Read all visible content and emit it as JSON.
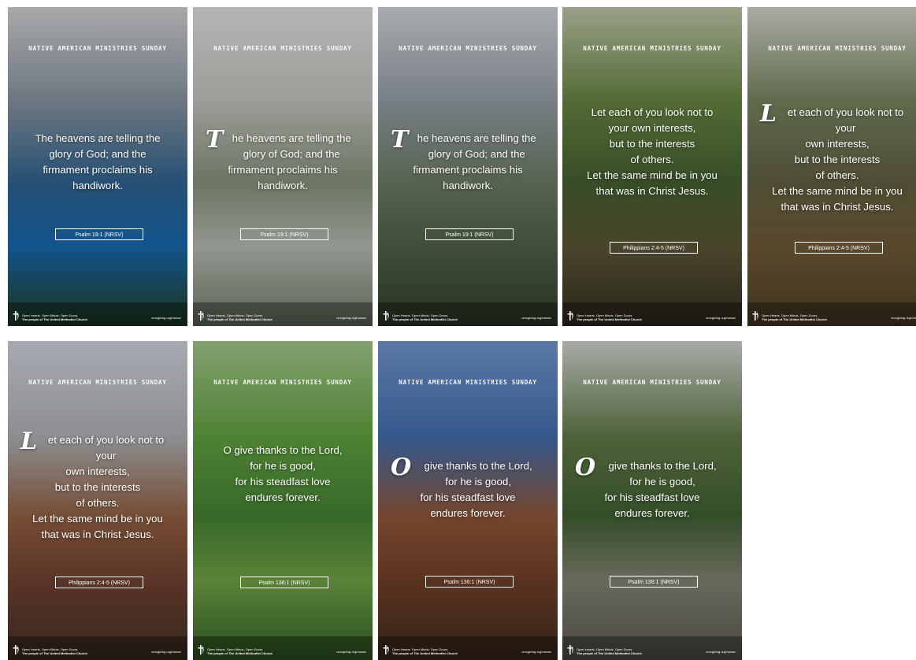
{
  "heading": "NATIVE AMERICAN MINISTRIES SUNDAY",
  "tagline_small": "Open Hearts. Open Minds. Open Doors.",
  "tagline_main": "The people of The United Methodist Church",
  "site": "umcgiving.org/namsc",
  "tiles": [
    {
      "cap": "",
      "quote": "The heavens are telling the\nglory of God; and the\nfirmament proclaims his\nhandiwork.",
      "ref": "Psalm 19:1 (NRSV)",
      "bg": [
        "#c9c9c9",
        "#7f8c97",
        "#2b5e88",
        "#1262a6",
        "#1d3b1c"
      ]
    },
    {
      "cap": "T",
      "quote": "he heavens are telling the\nglory of God; and the\nfirmament proclaims his\nhandiwork.",
      "ref": "Psalm 19:1 (NRSV)",
      "bg": [
        "#d8d8d6",
        "#b9bcb4",
        "#7f8a72",
        "#aeb4aa",
        "#6b7562"
      ]
    },
    {
      "cap": "T",
      "quote": "he heavens are telling the\nglory of God; and the\nfirmament proclaims his\nhandiwork.",
      "ref": "Psalm 19:1 (NRSV)",
      "bg": [
        "#c8ccd0",
        "#8d969c",
        "#65745c",
        "#4a5b40",
        "#2d3a26"
      ]
    },
    {
      "cap": "",
      "quote": "Let each of you look not to\nyour own interests,\nbut to the interests\nof others.\nLet the same mind be in you\nthat was in Christ Jesus.",
      "ref": "Philippians 2:4-5 (NRSV)",
      "bg": [
        "#b7bfa0",
        "#5f7d3a",
        "#3f5a2a",
        "#55502f",
        "#2e2a1c"
      ]
    },
    {
      "cap": "L",
      "quote": "et each of you look not to your\nown interests,\nbut to the interests\nof others.\nLet the same mind be in you\nthat was in Christ Jesus.",
      "ref": "Philippians 2:4-5 (NRSV)",
      "bg": [
        "#c9ccc0",
        "#6f7d56",
        "#5b5a3a",
        "#6a5430",
        "#4a3a22"
      ]
    },
    {
      "cap": "L",
      "quote": "et each of you look not to your\nown interests,\nbut to the interests\nof others.\nLet the same mind be in you\nthat was in Christ Jesus.",
      "ref": "Philippians 2:4-5 (NRSV)",
      "bg": [
        "#c7cbd2",
        "#a7a9ac",
        "#8c5a3b",
        "#6a3c2a",
        "#3c2b1e"
      ]
    },
    {
      "cap": "",
      "quote": "O give thanks to the Lord,\nfor he is good,\nfor his steadfast love\nendures forever.",
      "ref": "Psalm 136:1 (NRSV)",
      "bg": [
        "#9bbf82",
        "#5c9a3a",
        "#3f7a2c",
        "#6a9b3f",
        "#305a20"
      ]
    },
    {
      "cap": "O",
      "quote": "give thanks to the Lord,\nfor he is good,\nfor his steadfast love\nendures forever.",
      "ref": "Psalm 136:1 (NRSV)",
      "bg": [
        "#6c8fc3",
        "#3c67a6",
        "#8a5132",
        "#6a3a22",
        "#3b2818"
      ]
    },
    {
      "cap": "O",
      "quote": "give thanks to the Lord,\nfor he is good,\nfor his steadfast love\nendures forever.",
      "ref": "Psalm 136:1 (NRSV)",
      "bg": [
        "#c8cbc6",
        "#5a7440",
        "#3b5a2c",
        "#7c7c6a",
        "#55524a"
      ]
    }
  ]
}
